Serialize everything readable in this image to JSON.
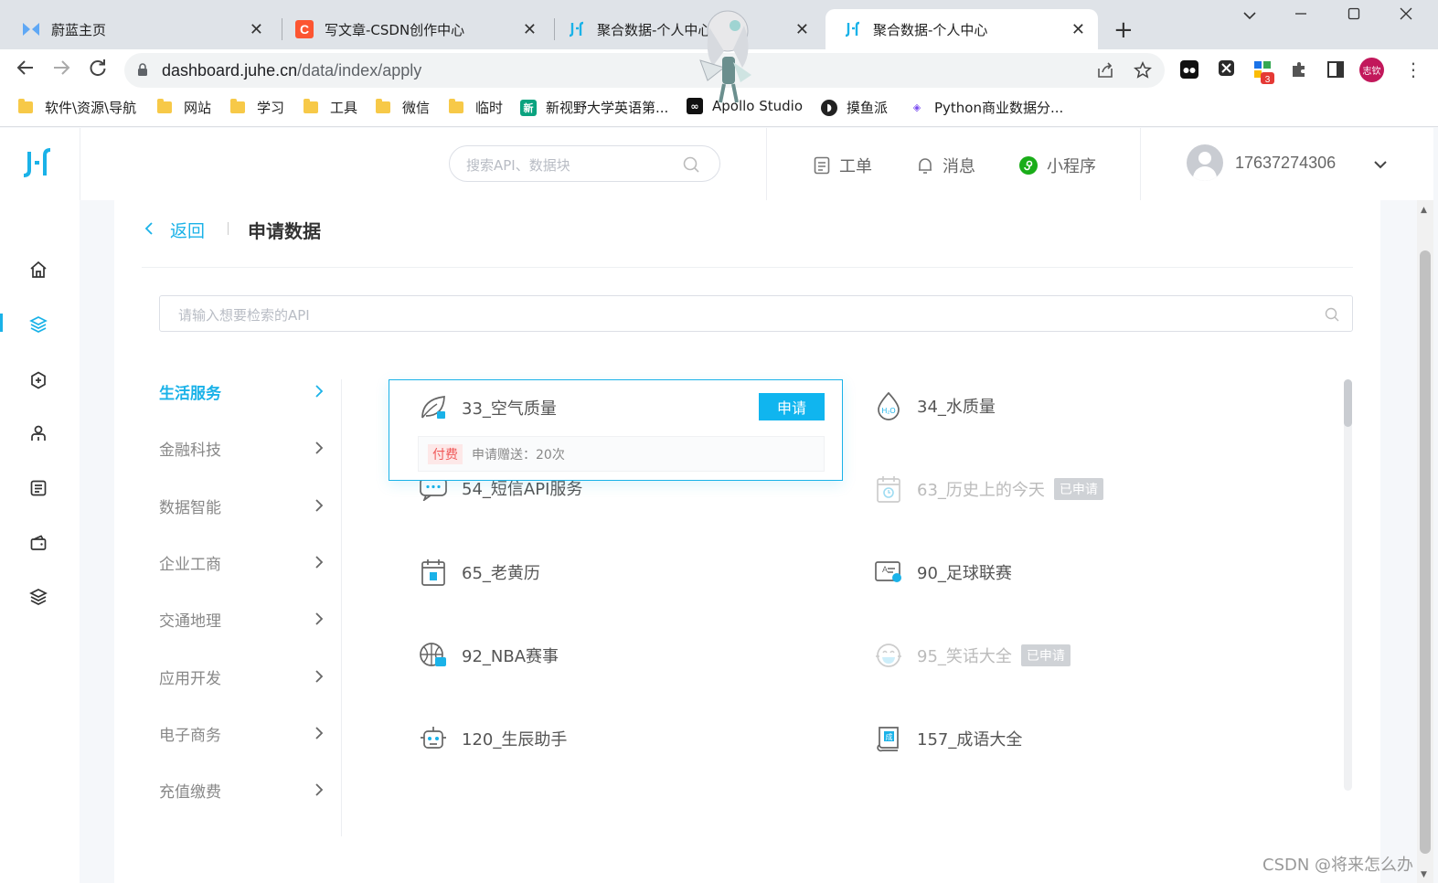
{
  "browser": {
    "tabs": [
      {
        "title": "蔚蓝主页",
        "favicon": "bowtie-icon"
      },
      {
        "title": "写文章-CSDN创作中心",
        "favicon": "csdn-icon",
        "favicon_letter": "C"
      },
      {
        "title": "聚合数据-个人中心",
        "favicon": "juhe-icon"
      },
      {
        "title": "聚合数据-个人中心",
        "favicon": "juhe-icon",
        "active": true
      }
    ],
    "url_host": "dashboard.juhe.cn",
    "url_path": "/data/index/apply",
    "extension_badge": "3",
    "profile_label": "志钦",
    "bookmarks": [
      {
        "label": "软件\\资源\\导航",
        "icon": "folder-icon"
      },
      {
        "label": "网站",
        "icon": "folder-icon"
      },
      {
        "label": "学习",
        "icon": "folder-icon"
      },
      {
        "label": "工具",
        "icon": "folder-icon"
      },
      {
        "label": "微信",
        "icon": "folder-icon"
      },
      {
        "label": "临时",
        "icon": "folder-icon"
      },
      {
        "label": "新视野大学英语第...",
        "icon": "book-icon"
      },
      {
        "label": "Apollo Studio",
        "icon": "apollo-icon"
      },
      {
        "label": "摸鱼派",
        "icon": "fish-icon"
      },
      {
        "label": "Python商业数据分...",
        "icon": "python-icon"
      }
    ]
  },
  "header": {
    "search_placeholder": "搜索API、数据块",
    "nav": [
      {
        "label": "工单",
        "icon": "ticket-icon"
      },
      {
        "label": "消息",
        "icon": "bell-icon"
      },
      {
        "label": "小程序",
        "icon": "mini-program-icon"
      }
    ],
    "user": "17637274306"
  },
  "page": {
    "back_label": "返回",
    "title": "申请数据",
    "search_placeholder": "请输入想要检索的API",
    "categories": [
      {
        "label": "生活服务",
        "active": true
      },
      {
        "label": "金融科技"
      },
      {
        "label": "数据智能"
      },
      {
        "label": "企业工商"
      },
      {
        "label": "交通地理"
      },
      {
        "label": "应用开发"
      },
      {
        "label": "电子商务"
      },
      {
        "label": "充值缴费"
      }
    ],
    "card": {
      "name": "33_空气质量",
      "apply_label": "申请",
      "paid_label": "付费",
      "gift_text": "申请赠送：20次"
    },
    "apis": [
      {
        "name": "34_水质量",
        "icon": "water-drop-icon"
      },
      {
        "name": "54_短信API服务",
        "icon": "sms-icon"
      },
      {
        "name": "63_历史上的今天",
        "icon": "calendar-history-icon",
        "tag": "已申请"
      },
      {
        "name": "65_老黄历",
        "icon": "almanac-icon"
      },
      {
        "name": "90_足球联赛",
        "icon": "football-card-icon"
      },
      {
        "name": "92_NBA赛事",
        "icon": "basketball-icon"
      },
      {
        "name": "95_笑话大全",
        "icon": "laugh-icon",
        "tag": "已申请"
      },
      {
        "name": "120_生辰助手",
        "icon": "robot-icon"
      },
      {
        "name": "157_成语大全",
        "icon": "idiom-book-icon"
      }
    ]
  },
  "watermark": "CSDN @将来怎么办",
  "colors": {
    "accent": "#1ab2e8",
    "button": "#10b5ef",
    "paid": "#f05a5a"
  }
}
